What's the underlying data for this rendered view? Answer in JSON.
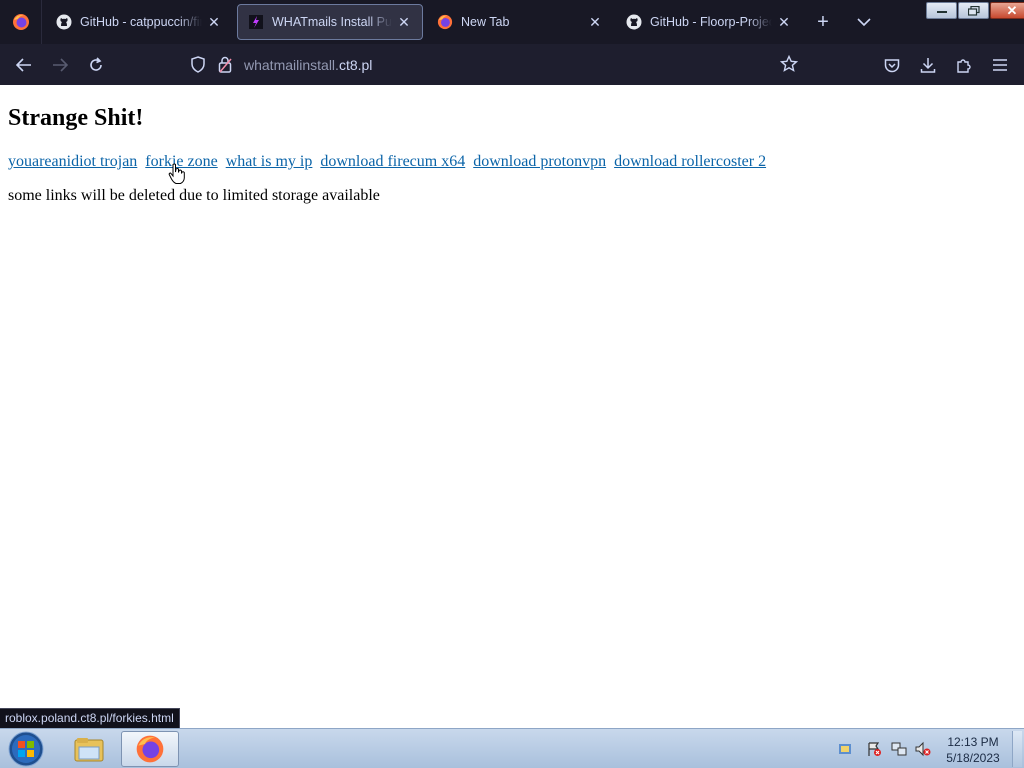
{
  "tabs": [
    {
      "title": "GitHub - catppuccin/firefox",
      "icon": "github-icon",
      "active": false
    },
    {
      "title": "WHATmails Install Pub Hub",
      "icon": "site-favicon-icon",
      "active": true
    },
    {
      "title": "New Tab",
      "icon": "firefox-icon",
      "active": false
    },
    {
      "title": "GitHub - Floorp-Projects",
      "icon": "github-icon",
      "active": false
    }
  ],
  "address_bar": {
    "url_prefix": "whatmailinstall.",
    "url_domain": "ct8.pl"
  },
  "page": {
    "heading": "Strange Shit!",
    "links": [
      "youareanidiot trojan",
      "forkie zone",
      "what is my ip",
      "download firecum x64",
      "download protonvpn",
      "download rollercoster 2"
    ],
    "note": "some links will be deleted due to limited storage available"
  },
  "status_bar": {
    "hover_url": "roblox.poland.ct8.pl/forkies.html"
  },
  "taskbar": {
    "time": "12:13 PM",
    "date": "5/18/2023"
  },
  "colors": {
    "tab_strip": "#181825",
    "nav_bar": "#1e1e2e",
    "link": "#0b64a8",
    "taskbar": "#b4c9e2"
  }
}
